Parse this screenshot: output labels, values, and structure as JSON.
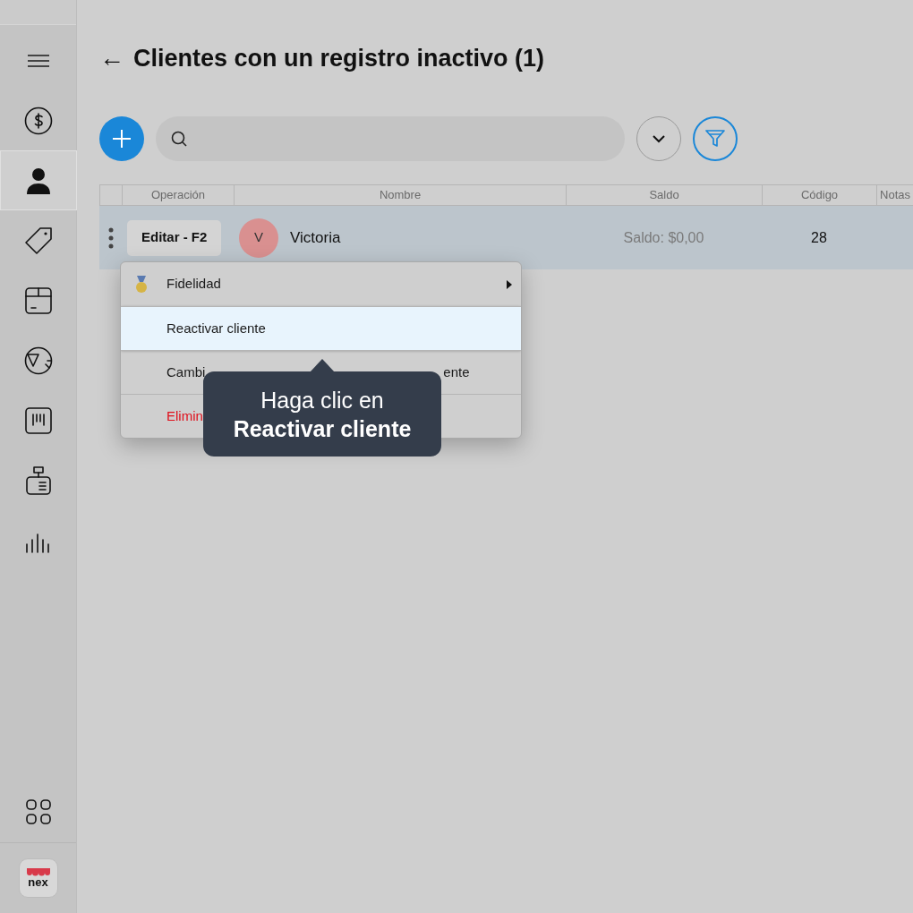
{
  "sidebar": {
    "items": [
      {
        "selected": false
      },
      {
        "selected": false
      },
      {
        "selected": true
      },
      {
        "selected": false
      },
      {
        "selected": false
      },
      {
        "selected": false
      },
      {
        "selected": false
      },
      {
        "selected": false
      },
      {
        "selected": false
      }
    ],
    "logo": "nex"
  },
  "header": {
    "back": "←",
    "title": "Clientes con un registro inactivo (1)"
  },
  "table": {
    "columns": [
      "",
      "Operación",
      "Nombre",
      "Saldo",
      "Código",
      "Notas"
    ],
    "rows": [
      {
        "selected": true,
        "edit_button": "Editar - F2",
        "avatar": "V",
        "name": "Victoria",
        "balance": "Saldo: $0,00",
        "code": "28"
      }
    ]
  },
  "context_menu": {
    "items": [
      {
        "kind": "submenu",
        "label": "Fidelidad",
        "highlighted": false,
        "danger": false
      },
      {
        "kind": "item",
        "label": "Reactivar cliente",
        "highlighted": true,
        "danger": false
      },
      {
        "kind": "partial",
        "label": "Cambi",
        "label_end": "ente",
        "highlighted": false,
        "danger": false
      },
      {
        "kind": "item",
        "label": "Elimin",
        "highlighted": false,
        "danger": true
      }
    ]
  },
  "tooltip": {
    "line1": "Haga clic en",
    "line2": "Reactivar cliente"
  }
}
